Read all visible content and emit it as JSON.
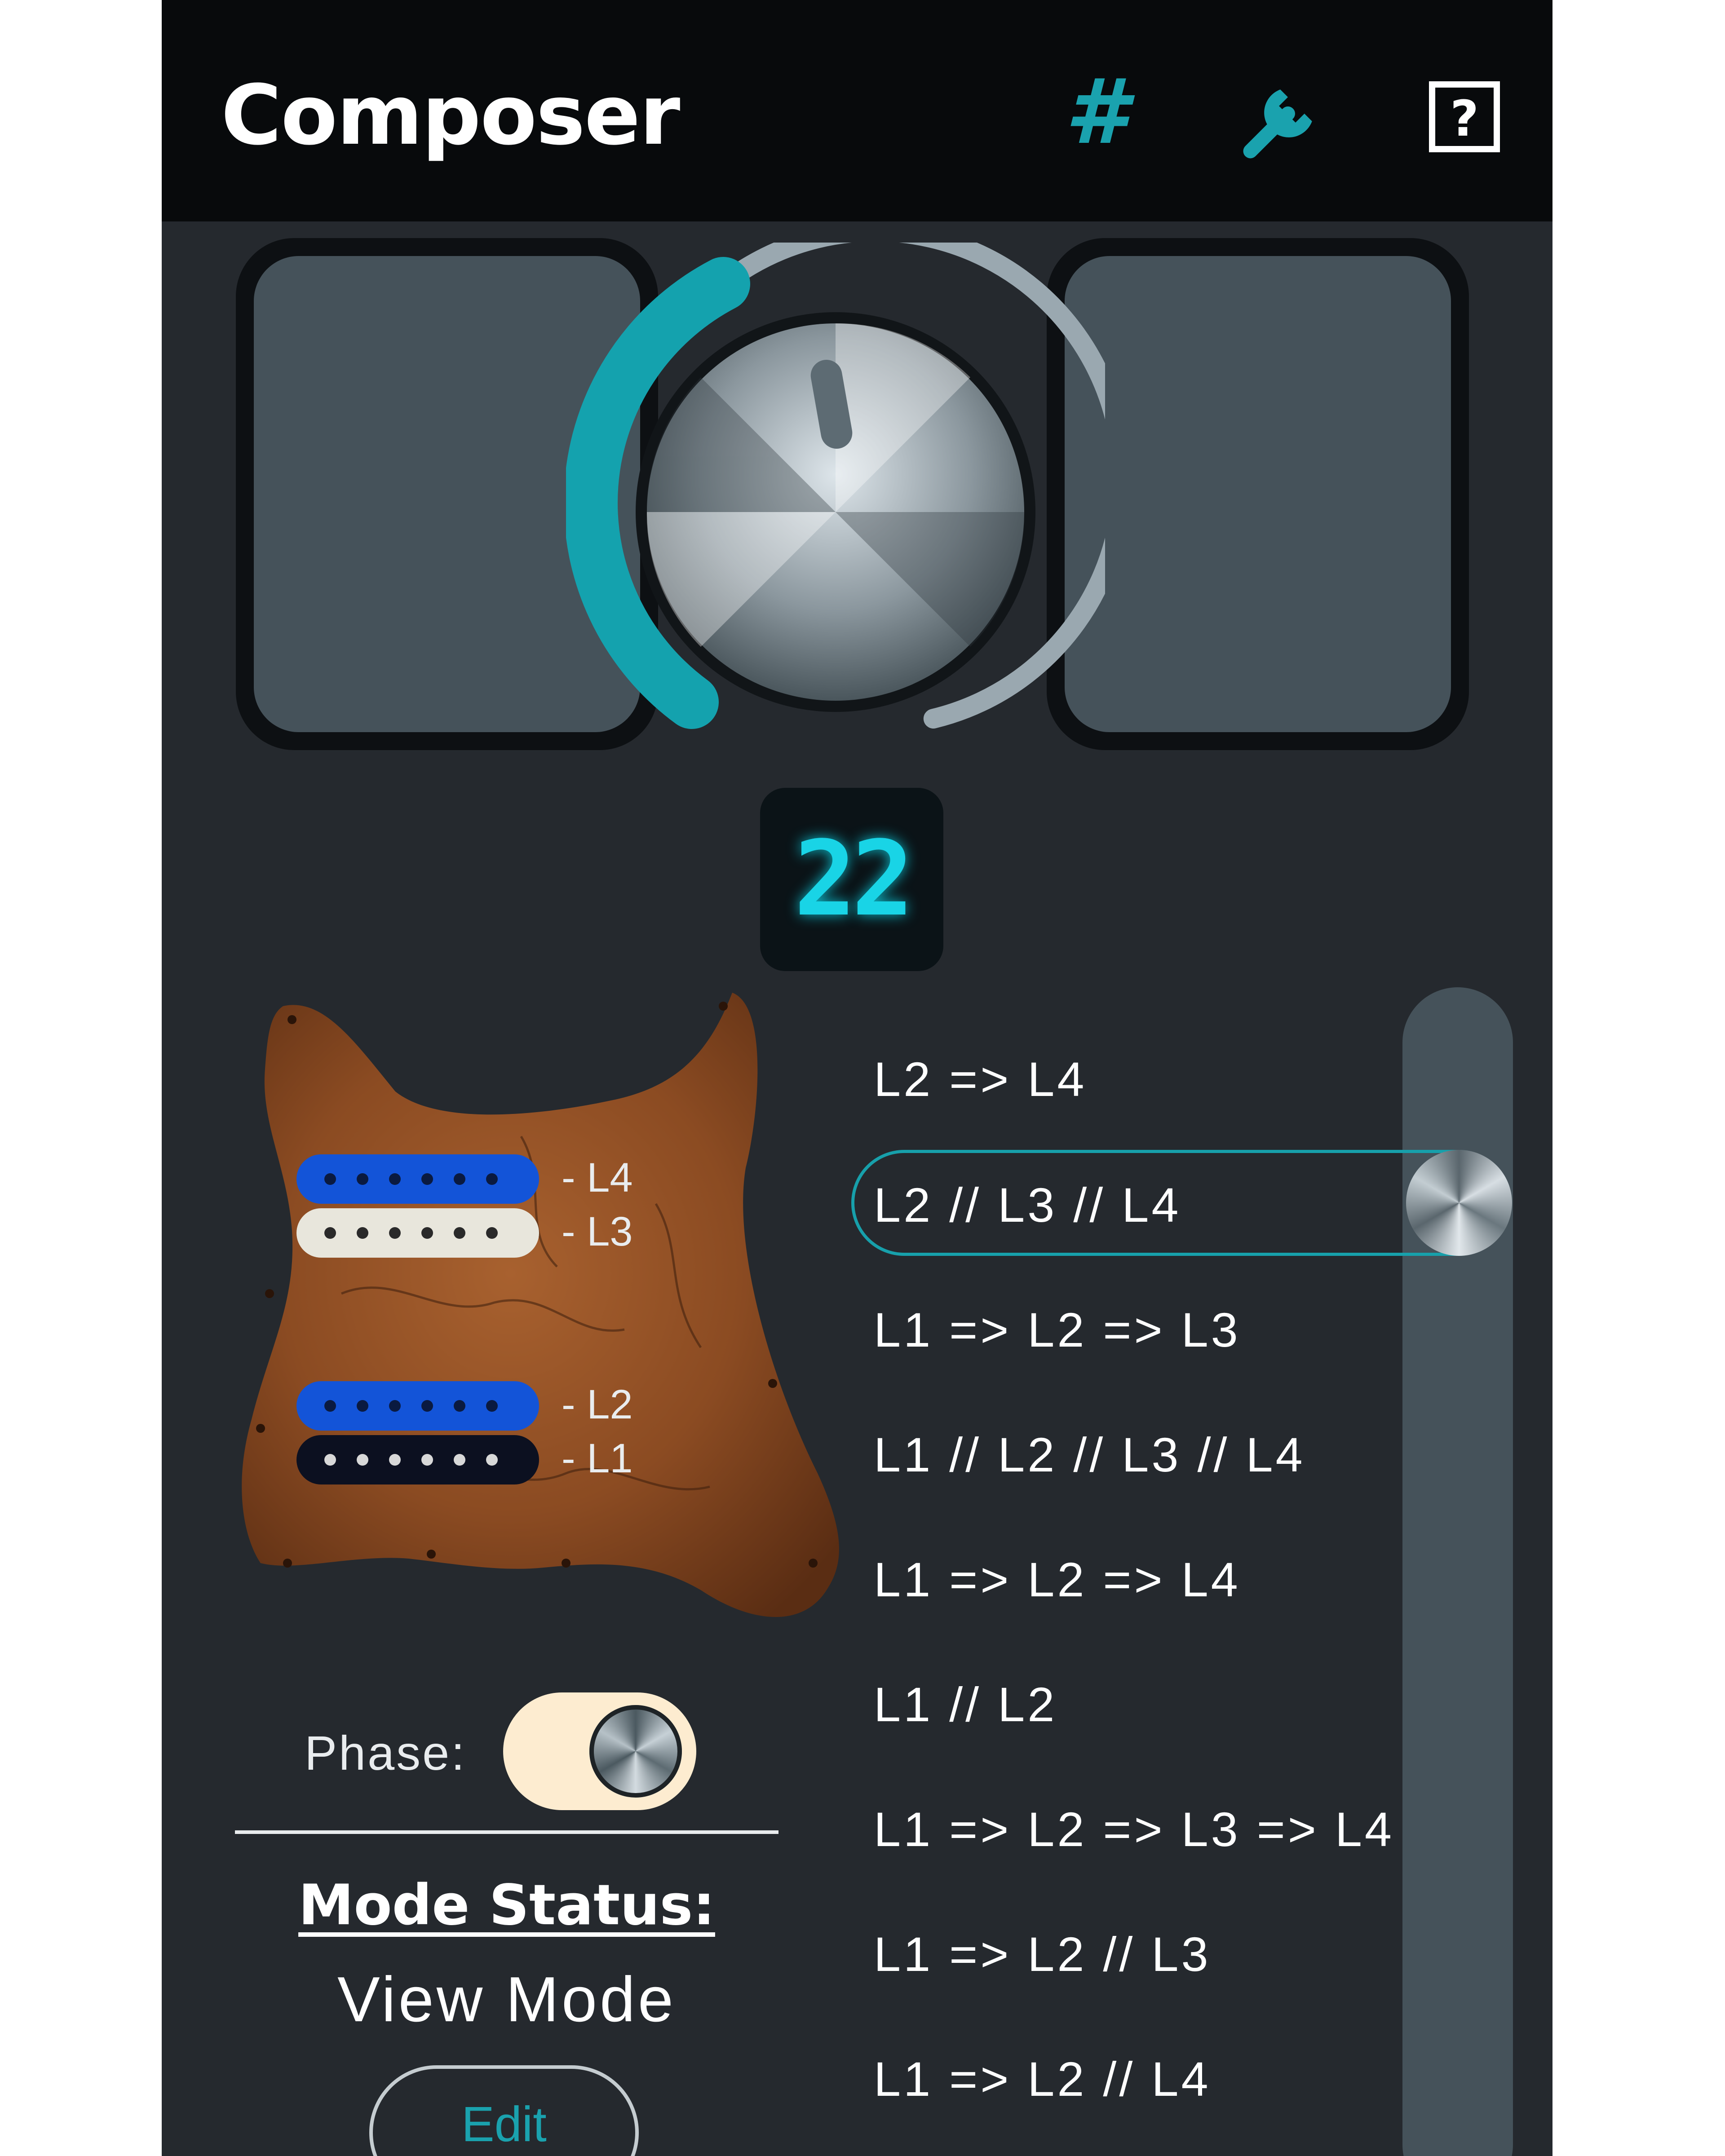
{
  "app": {
    "title": "Composer",
    "toolbar": {
      "hash_icon": "hash-icon",
      "hash_glyph": "#",
      "settings_icon": "wrench-icon",
      "help_icon": "help-icon",
      "accent_color": "#1aa2ae"
    }
  },
  "selector_knob": {
    "position_display": "22",
    "level_fraction": 0.3
  },
  "guitar": {
    "pickups": [
      {
        "label": "- L4",
        "color": "#1354d8"
      },
      {
        "label": "- L3",
        "color": "#e8e6dc"
      },
      {
        "label": "- L2",
        "color": "#1354d8"
      },
      {
        "label": "- L1",
        "color": "#0c1020"
      }
    ]
  },
  "phase": {
    "label": "Phase:",
    "on": true
  },
  "mode": {
    "status_label": "Mode Status:",
    "value": "View Mode",
    "edit_label": "Edit"
  },
  "configs": {
    "selected_index": 1,
    "items": [
      "L2 => L4",
      "L2 // L3 // L4",
      "L1 => L2 => L3",
      "L1 // L2 // L3 // L4",
      "L1 => L2 => L4",
      "L1 // L2",
      "L1 => L2 => L3 => L4",
      "L1 => L2 // L3",
      "L1 => L2 // L4"
    ]
  }
}
